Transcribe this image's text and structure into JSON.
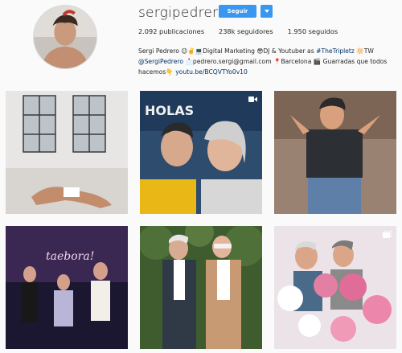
{
  "profile": {
    "username": "sergipedrero",
    "follow_label": "Seguir",
    "stats": {
      "posts": "2.092 publicaciones",
      "followers": "238k seguidores",
      "following": "1.950 seguidos"
    },
    "bio": {
      "name": "Sergi Pedrero",
      "line1_rest": " 😉✌️💻Digital Marketing 😎DJ & Youtuber as ",
      "tag1": "#TheTripletz",
      "line1_end": " 🔆TW",
      "mention": "@SergiPedrero",
      "line2_rest": " 📩pedrero.sergi@gmail.com 📍Barcelona 🎬 Guarradas que todos",
      "line3_start": "hacemos👇 ",
      "link": "youtu.be/BCQVTYo0v10"
    }
  },
  "colors": {
    "accent": "#3897f0",
    "link": "#003569",
    "text": "#262626"
  },
  "posts": [
    {
      "id": "post-1",
      "icon": ""
    },
    {
      "id": "post-2",
      "icon": "video-icon"
    },
    {
      "id": "post-3",
      "icon": ""
    },
    {
      "id": "post-4",
      "icon": ""
    },
    {
      "id": "post-5",
      "icon": ""
    },
    {
      "id": "post-6",
      "icon": "multiple-photos-icon"
    }
  ],
  "post_texts": {
    "sign_post2": "HOLAS",
    "sign_post4": "taebora!"
  }
}
